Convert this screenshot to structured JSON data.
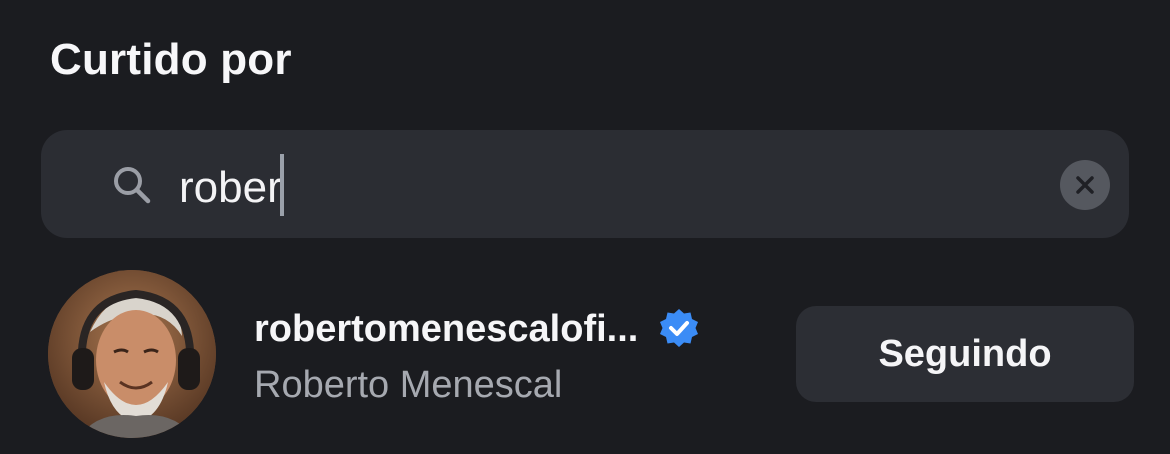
{
  "header": {
    "title": "Curtido por"
  },
  "search": {
    "value": "rober",
    "icon": "search-icon",
    "clear_icon": "clear-icon"
  },
  "results": [
    {
      "username": "robertomenescalofi...",
      "full_name": "Roberto Menescal",
      "verified": true,
      "follow_label": "Seguindo",
      "avatar_icon": "avatar"
    }
  ],
  "colors": {
    "background": "#1b1c20",
    "search_field": "#2b2d33",
    "verified_badge": "#3b8cf6",
    "secondary_text": "#a6a9b0",
    "button": "#2c2e34"
  }
}
